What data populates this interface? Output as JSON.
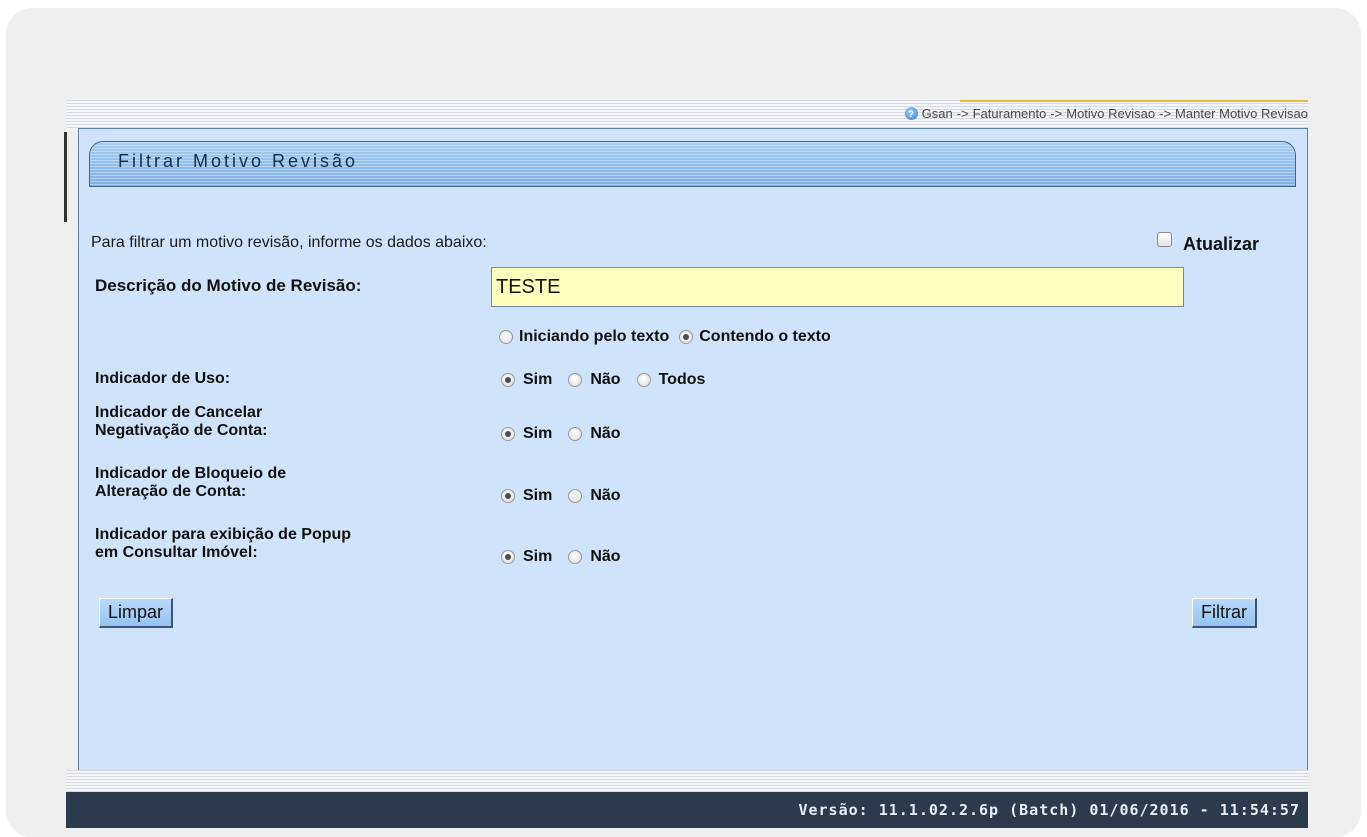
{
  "breadcrumb": {
    "parts": [
      "Gsan",
      "Faturamento",
      "Motivo Revisao",
      "Manter Motivo Revisao"
    ],
    "separator": "->"
  },
  "panel": {
    "title": "Filtrar Motivo Revisão",
    "instructions": "Para filtrar um motivo revisão, informe os dados abaixo:",
    "atualizar_label": "Atualizar",
    "atualizar_checked": false
  },
  "descricao": {
    "label": "Descrição do Motivo de Revisão:",
    "value": "TESTE",
    "match_options": [
      {
        "label": "Iniciando pelo texto",
        "checked": false
      },
      {
        "label": "Contendo o texto",
        "checked": true
      }
    ]
  },
  "indicador_uso": {
    "label": "Indicador de Uso:",
    "options": [
      {
        "label": "Sim",
        "checked": true
      },
      {
        "label": "Não",
        "checked": false
      },
      {
        "label": "Todos",
        "checked": false
      }
    ]
  },
  "indicador_cancelar": {
    "label_line1": "Indicador de Cancelar",
    "label_line2": "Negativação de Conta:",
    "options": [
      {
        "label": "Sim",
        "checked": true
      },
      {
        "label": "Não",
        "checked": false
      }
    ]
  },
  "indicador_bloqueio": {
    "label_line1": "Indicador de Bloqueio de",
    "label_line2": "Alteração de Conta:",
    "options": [
      {
        "label": "Sim",
        "checked": true
      },
      {
        "label": "Não",
        "checked": false
      }
    ]
  },
  "indicador_popup": {
    "label_line1": "Indicador para exibição de Popup",
    "label_line2": "em Consultar Imóvel:",
    "options": [
      {
        "label": "Sim",
        "checked": true
      },
      {
        "label": "Não",
        "checked": false
      }
    ]
  },
  "buttons": {
    "limpar": "Limpar",
    "filtrar": "Filtrar"
  },
  "footer": {
    "version": "Versão: 11.1.02.2.6p (Batch) 01/06/2016 - 11:54:57"
  }
}
